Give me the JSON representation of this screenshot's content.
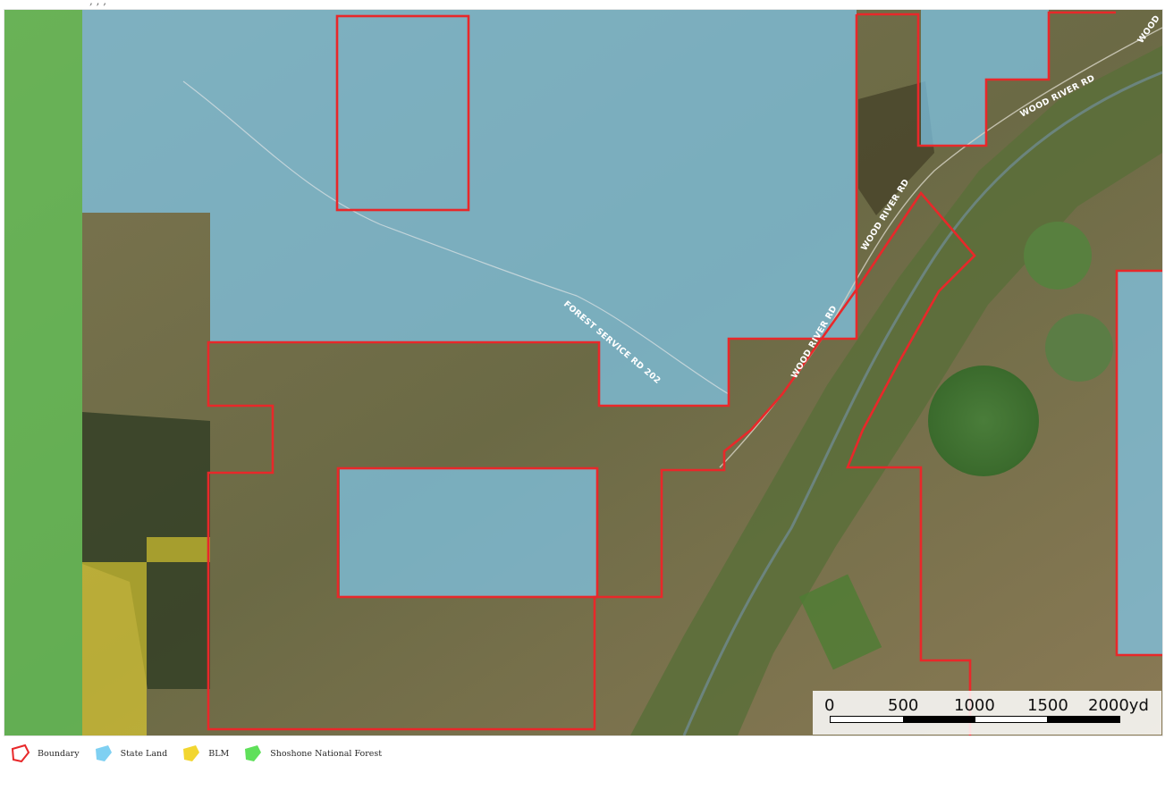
{
  "map": {
    "roads": {
      "forest_service_rd": "FOREST SERVICE RD 202",
      "wood_river_rd_a": "WOOD RIVER RD",
      "wood_river_rd_b": "WOOD RIVER RD",
      "wood_river_rd_c": "WOOD RIVER RD",
      "wood_river_rd_d": "WOOD"
    },
    "colors": {
      "boundary": "#e8282a",
      "state_land": "#7fc8ec",
      "blm": "#e8d530",
      "national_forest": "#5fd35a"
    }
  },
  "scale_bar": {
    "ticks": [
      "0",
      "500",
      "1000",
      "1500",
      "2000yd"
    ]
  },
  "legend": {
    "items": [
      {
        "label": "Boundary",
        "icon": "boundary-polygon-icon"
      },
      {
        "label": "State Land",
        "icon": "state-land-polygon-icon"
      },
      {
        "label": "BLM",
        "icon": "blm-polygon-icon"
      },
      {
        "label": "Shoshone National Forest",
        "icon": "national-forest-polygon-icon"
      }
    ]
  }
}
